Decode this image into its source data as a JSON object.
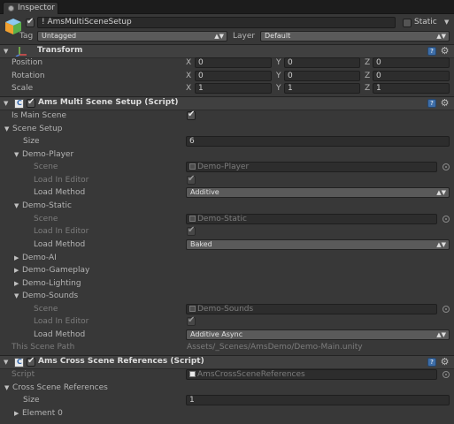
{
  "tab": {
    "label": "Inspector"
  },
  "header": {
    "object_name": "! AmsMultiSceneSetup",
    "static_label": "Static",
    "tag_label": "Tag",
    "tag_value": "Untagged",
    "layer_label": "Layer",
    "layer_value": "Default"
  },
  "transform": {
    "title": "Transform",
    "rows": [
      {
        "label": "Position",
        "x": "0",
        "y": "0",
        "z": "0"
      },
      {
        "label": "Rotation",
        "x": "0",
        "y": "0",
        "z": "0"
      },
      {
        "label": "Scale",
        "x": "1",
        "y": "1",
        "z": "1"
      }
    ],
    "axis_x": "X",
    "axis_y": "Y",
    "axis_z": "Z"
  },
  "multi": {
    "title": "Ams Multi Scene Setup (Script)",
    "is_main_label": "Is Main Scene",
    "scene_setup_label": "Scene Setup",
    "size_label": "Size",
    "size_value": "6",
    "scene_label": "Scene",
    "load_in_editor_label": "Load In Editor",
    "load_method_label": "Load Method",
    "player": {
      "name": "Demo-Player",
      "scene": "Demo-Player",
      "method": "Additive"
    },
    "static": {
      "name": "Demo-Static",
      "scene": "Demo-Static",
      "method": "Baked"
    },
    "ai": {
      "name": "Demo-AI"
    },
    "gameplay": {
      "name": "Demo-Gameplay"
    },
    "lighting": {
      "name": "Demo-Lighting"
    },
    "sounds": {
      "name": "Demo-Sounds",
      "scene": "Demo-Sounds",
      "method": "Additive Async"
    },
    "path_label": "This Scene Path",
    "path_value": "Assets/_Scenes/AmsDemo/Demo-Main.unity"
  },
  "cross": {
    "title": "Ams Cross Scene References (Script)",
    "script_label": "Script",
    "script_value": "AmsCrossSceneReferences",
    "refs_label": "Cross Scene References",
    "size_label": "Size",
    "size_value": "1",
    "element_label": "Element 0"
  }
}
